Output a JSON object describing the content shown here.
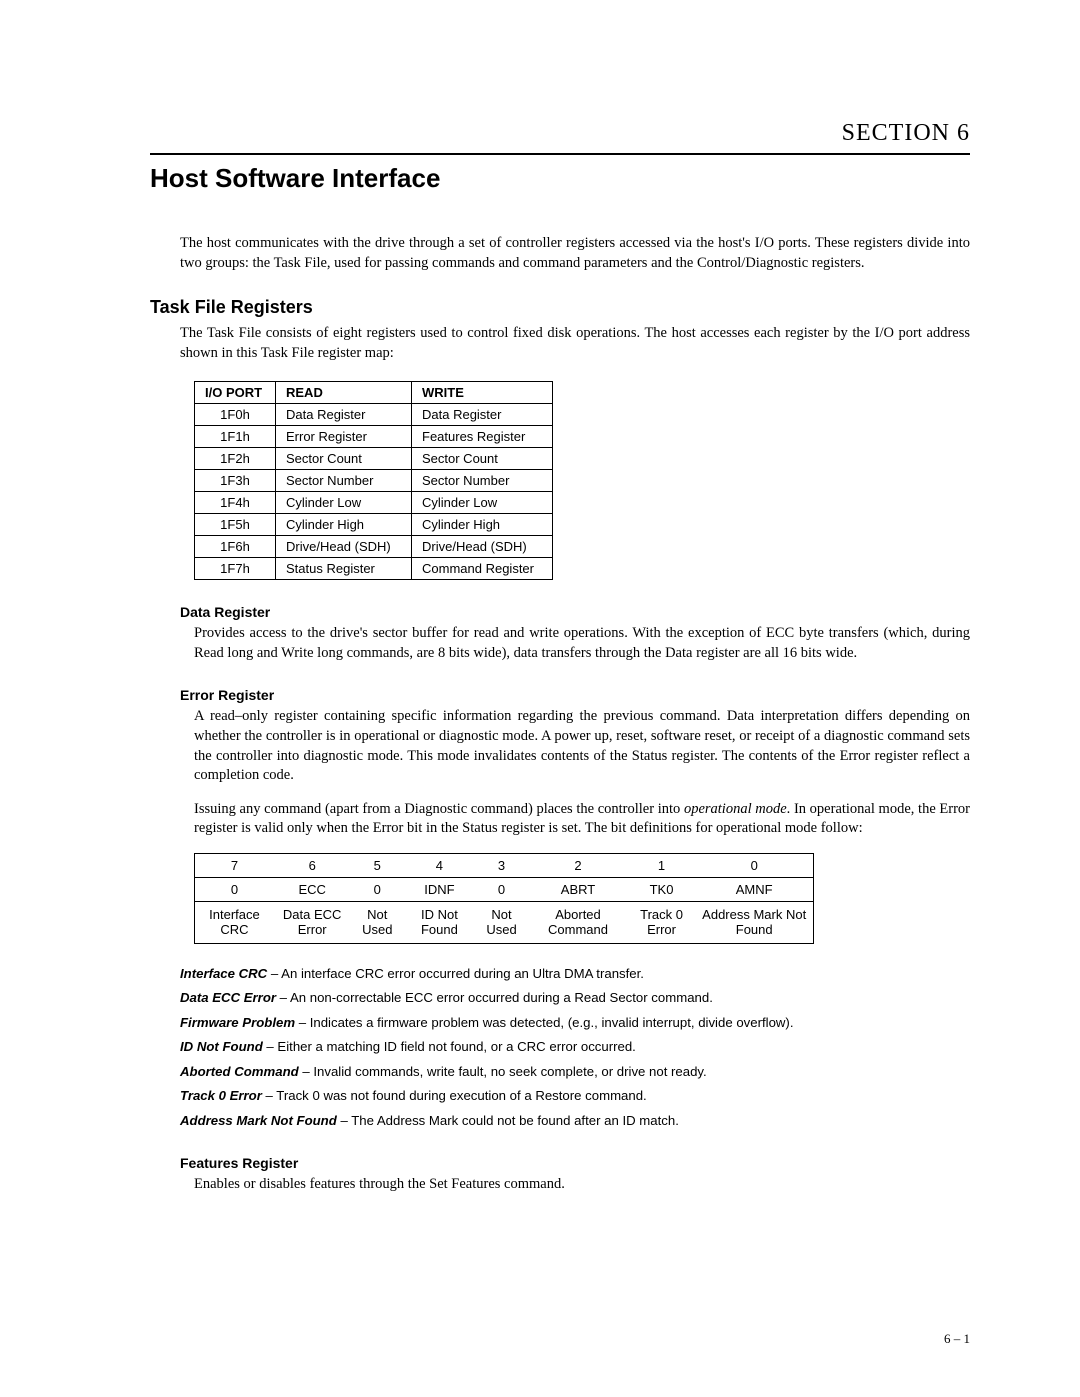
{
  "section_label": "SECTION 6",
  "main_title": "Host Software Interface",
  "intro": "The host communicates with the drive through a set of controller registers accessed via the host's I/O ports. These registers divide into two groups: the Task File, used for passing commands and command parameters and the Control/Diagnostic registers.",
  "task_file": {
    "heading": "Task File Registers",
    "intro": "The Task File consists of eight registers used to control fixed disk operations. The host accesses each register by the I/O port address shown in this Task File register map:",
    "headers": {
      "c0": "I/O PORT",
      "c1": "READ",
      "c2": "WRITE"
    },
    "rows": [
      {
        "port": "1F0h",
        "read": "Data Register",
        "write": "Data Register"
      },
      {
        "port": "1F1h",
        "read": "Error Register",
        "write": "Features Register"
      },
      {
        "port": "1F2h",
        "read": "Sector Count",
        "write": "Sector Count"
      },
      {
        "port": "1F3h",
        "read": "Sector Number",
        "write": "Sector Number"
      },
      {
        "port": "1F4h",
        "read": "Cylinder Low",
        "write": "Cylinder Low"
      },
      {
        "port": "1F5h",
        "read": "Cylinder High",
        "write": "Cylinder High"
      },
      {
        "port": "1F6h",
        "read": "Drive/Head (SDH)",
        "write": "Drive/Head (SDH)"
      },
      {
        "port": "1F7h",
        "read": "Status Register",
        "write": "Command Register"
      }
    ]
  },
  "data_register": {
    "heading": "Data Register",
    "body": "Provides access to the drive's sector buffer for read and write operations. With the exception of ECC byte transfers (which, during Read long and Write long commands, are 8 bits wide), data transfers through the Data register are all 16 bits wide."
  },
  "error_register": {
    "heading": "Error Register",
    "body1": "A read–only register containing specific information regarding the previous command. Data interpretation differs depending on whether the controller is in operational or diagnostic mode. A power up, reset, software reset, or receipt of a diagnostic command sets the controller into diagnostic mode. This mode invalidates contents of the Status register. The contents of the Error register reflect a completion code.",
    "body2_pre": "Issuing any command (apart from a Diagnostic command) places the controller into ",
    "body2_em": "operational mode",
    "body2_post": ". In operational mode, the Error register is valid only when the Error bit in the Status register is set. The bit definitions for operational mode follow:",
    "bits": {
      "nums": [
        "7",
        "6",
        "5",
        "4",
        "3",
        "2",
        "1",
        "0"
      ],
      "short": [
        "0",
        "ECC",
        "0",
        "IDNF",
        "0",
        "ABRT",
        "TK0",
        "AMNF"
      ],
      "long": [
        "Interface CRC",
        "Data ECC Error",
        "Not Used",
        "ID Not Found",
        "Not Used",
        "Aborted Command",
        "Track 0 Error",
        "Address Mark Not Found"
      ]
    },
    "defs": [
      {
        "term": "Interface CRC",
        "desc": " – An interface CRC error occurred during an Ultra DMA transfer."
      },
      {
        "term": "Data ECC Error",
        "desc": " – An non-correctable ECC error occurred during a Read Sector command."
      },
      {
        "term": "Firmware Problem",
        "desc": " – Indicates a firmware problem was detected, (e.g., invalid interrupt, divide overflow)."
      },
      {
        "term": "ID Not Found",
        "desc": " – Either a matching ID field not found, or a CRC error occurred."
      },
      {
        "term": "Aborted Command",
        "desc": " – Invalid commands, write fault, no seek complete, or drive not ready."
      },
      {
        "term": "Track 0 Error",
        "desc": " – Track 0 was not found during execution of a Restore command."
      },
      {
        "term": "Address Mark Not Found",
        "desc": " – The Address Mark could not be found after an ID match."
      }
    ]
  },
  "features_register": {
    "heading": "Features Register",
    "body": "Enables or disables features through the Set Features command."
  },
  "page_num": "6 – 1"
}
